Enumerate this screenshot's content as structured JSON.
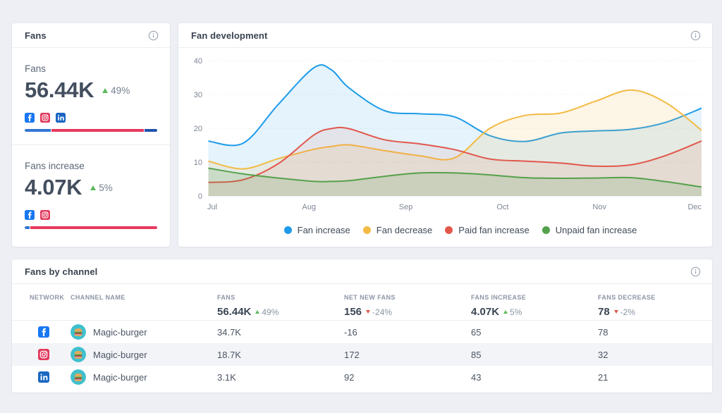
{
  "page": {
    "background": "#edeff4"
  },
  "colors": {
    "facebook": "#1877f2",
    "instagram": "#e23a5f",
    "linkedin": "#1a66c2",
    "bar_navy": "#2053ad",
    "up": "#5cb85c",
    "down": "#e2574c"
  },
  "fans_card": {
    "title": "Fans",
    "metrics": [
      {
        "label": "Fans",
        "value": "56.44K",
        "change": "49%",
        "direction": "up",
        "networks": [
          "facebook",
          "instagram",
          "linkedin"
        ],
        "bar": [
          {
            "network": "facebook",
            "color": "#3276d2",
            "pct": 20
          },
          {
            "network": "instagram",
            "color": "#e8395f",
            "pct": 70.5
          },
          {
            "network": "linkedin",
            "color": "#2053ad",
            "pct": 9.5
          }
        ]
      },
      {
        "label": "Fans increase",
        "value": "4.07K",
        "change": "5%",
        "direction": "up",
        "networks": [
          "facebook",
          "instagram"
        ],
        "bar": [
          {
            "network": "facebook",
            "color": "#3276d2",
            "pct": 3.5
          },
          {
            "network": "instagram",
            "color": "#e8395f",
            "pct": 96.5
          }
        ]
      }
    ]
  },
  "chart_card": {
    "title": "Fan development"
  },
  "chart_data": {
    "type": "area",
    "title": "Fan development",
    "x_labels": [
      "Jul",
      "Aug",
      "Sep",
      "Oct",
      "Nov",
      "Dec"
    ],
    "x_month_units": [
      -0.04,
      0.32,
      0.68,
      1.05,
      1.23,
      1.41,
      1.78,
      2.14,
      2.5,
      2.87,
      3.23,
      3.6,
      3.96,
      4.33,
      4.69,
      5.06
    ],
    "series": [
      {
        "name": "Fan increase",
        "color": "#1f9ce9",
        "fill_opacity": 0.12,
        "values": [
          16.2,
          15.6,
          27.0,
          37.9,
          37.3,
          32.0,
          25.2,
          24.3,
          23.4,
          17.8,
          16.1,
          18.6,
          19.2,
          19.7,
          21.8,
          26.0
        ]
      },
      {
        "name": "Fan decrease",
        "color": "#f3bb45",
        "fill_opacity": 0.14,
        "values": [
          10.3,
          8.0,
          11.0,
          13.8,
          14.6,
          15.1,
          13.4,
          11.9,
          11.2,
          20.0,
          23.8,
          24.5,
          28.0,
          31.3,
          27.5,
          19.3
        ]
      },
      {
        "name": "Paid fan increase",
        "color": "#e2574c",
        "fill_opacity": 0.1,
        "values": [
          4.0,
          4.8,
          9.5,
          18.0,
          19.9,
          19.9,
          16.6,
          15.4,
          13.7,
          10.9,
          10.3,
          9.7,
          8.8,
          9.2,
          12.0,
          16.3
        ]
      },
      {
        "name": "Unpaid fan increase",
        "color": "#55a14b",
        "fill_opacity": 0.18,
        "values": [
          8.2,
          6.5,
          5.3,
          4.3,
          4.3,
          4.5,
          5.8,
          6.8,
          6.8,
          6.2,
          5.4,
          5.2,
          5.3,
          5.4,
          4.2,
          2.6
        ]
      }
    ],
    "ylim": [
      0,
      40
    ],
    "yticks": [
      0,
      10,
      20,
      30,
      40
    ],
    "grid": "dotted horizontal lines at yticks",
    "legend_position": "bottom"
  },
  "table_card": {
    "title": "Fans by channel",
    "columns": [
      "NETWORK",
      "CHANNEL NAME",
      "FANS",
      "NET NEW FANS",
      "FANS INCREASE",
      "FANS DECREASE"
    ],
    "totals": [
      {
        "value": "56.44K",
        "change": "49%",
        "direction": "up"
      },
      {
        "value": "156",
        "change": "-24%",
        "direction": "down"
      },
      {
        "value": "4.07K",
        "change": "5%",
        "direction": "up"
      },
      {
        "value": "78",
        "change": "-2%",
        "direction": "down"
      }
    ],
    "rows": [
      {
        "network": "facebook",
        "channel": "Magic-burger",
        "fans": "34.7K",
        "net_new_fans": "-16",
        "fans_increase": "65",
        "fans_decrease": "78",
        "shaded": false
      },
      {
        "network": "instagram",
        "channel": "Magic-burger",
        "fans": "18.7K",
        "net_new_fans": "172",
        "fans_increase": "85",
        "fans_decrease": "32",
        "shaded": true
      },
      {
        "network": "linkedin",
        "channel": "Magic-burger",
        "fans": "3.1K",
        "net_new_fans": "92",
        "fans_increase": "43",
        "fans_decrease": "21",
        "shaded": false
      }
    ]
  }
}
